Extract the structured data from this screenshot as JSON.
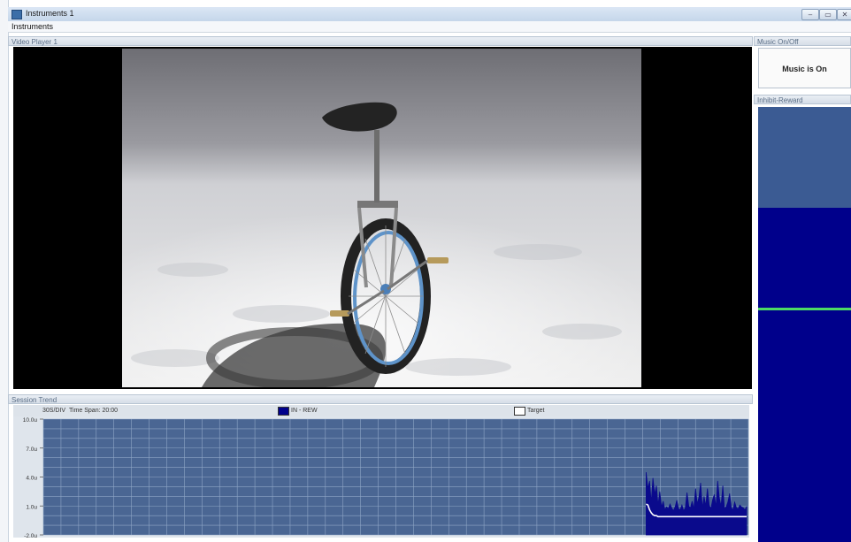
{
  "window": {
    "title": "Instruments 1",
    "controls": {
      "minimize": "–",
      "restore": "▭",
      "close": "✕"
    }
  },
  "menu": {
    "items": [
      "Instruments"
    ]
  },
  "panels": {
    "video_player": {
      "title": "Video Player 1"
    },
    "music": {
      "title": "Music On/Off",
      "status": "Music is On"
    },
    "inhibit_reward": {
      "title": "Inhibit-Reward",
      "upper_bar_color": "#3b5b93",
      "lower_bar_color": "#00008b",
      "threshold_line_color": "#4cd964"
    },
    "session_trend": {
      "title": "Session Trend",
      "div_label": "30S/DIV",
      "time_span": "Time Span: 20:00",
      "legend": [
        {
          "label": "IN - REW",
          "color": "#00008b"
        },
        {
          "label": "Target",
          "color": "#ffffff"
        }
      ]
    }
  },
  "colors": {
    "plot_bg": "#4a6693",
    "grid": "#8fa6c6",
    "series_main": "#0a0a8c",
    "series_target": "#ffffff"
  },
  "chart_data": {
    "type": "line",
    "yticks": [
      "10.0u",
      "7.0u",
      "4.0u",
      "1.0u",
      "-2.0u"
    ],
    "ylim": [
      -2.0,
      10.0
    ],
    "grid": true,
    "x_divisions": 40,
    "series": [
      {
        "name": "IN - REW",
        "values": [
          4.5,
          2.8,
          3.6,
          1.4,
          3.9,
          2.2,
          3.1,
          1.1,
          2.5,
          0.9,
          1.5,
          0.6,
          0.9,
          0.7,
          1.2,
          0.8,
          0.5,
          0.9,
          1.6,
          0.7,
          0.6,
          1.1,
          0.5,
          0.8,
          2.4,
          1.0,
          0.8,
          1.5,
          0.7,
          2.8,
          1.2,
          1.9,
          3.4,
          0.8,
          2.0,
          1.0,
          2.8,
          1.1,
          0.7,
          1.6,
          2.2,
          0.9,
          3.6,
          1.8,
          1.0,
          3.1,
          0.7,
          0.9,
          1.4,
          2.3,
          0.8,
          0.6,
          1.4,
          0.8,
          0.7,
          1.1,
          0.9,
          0.8,
          0.6,
          0.9
        ]
      },
      {
        "name": "Target",
        "values": [
          1.2,
          1.1,
          0.6,
          0.3,
          0.1,
          0.0,
          0.0,
          -0.1,
          -0.1,
          -0.1,
          -0.1,
          -0.1,
          -0.1,
          -0.1,
          -0.1,
          -0.1,
          -0.1,
          -0.1,
          -0.1,
          -0.1,
          -0.1,
          -0.1,
          -0.1,
          -0.1,
          -0.1,
          -0.1,
          -0.1,
          -0.1,
          -0.1,
          -0.1,
          -0.1,
          -0.1,
          -0.1,
          -0.1,
          -0.1,
          -0.1,
          -0.1,
          -0.1,
          -0.1,
          -0.1,
          -0.1,
          -0.1,
          -0.1,
          -0.1,
          -0.1,
          -0.1,
          -0.1,
          -0.1,
          -0.1,
          -0.1,
          -0.1,
          -0.1,
          -0.1,
          -0.1,
          -0.1,
          -0.1,
          -0.1,
          -0.1,
          -0.1,
          -0.1
        ]
      }
    ],
    "data_start_fraction": 0.855
  }
}
